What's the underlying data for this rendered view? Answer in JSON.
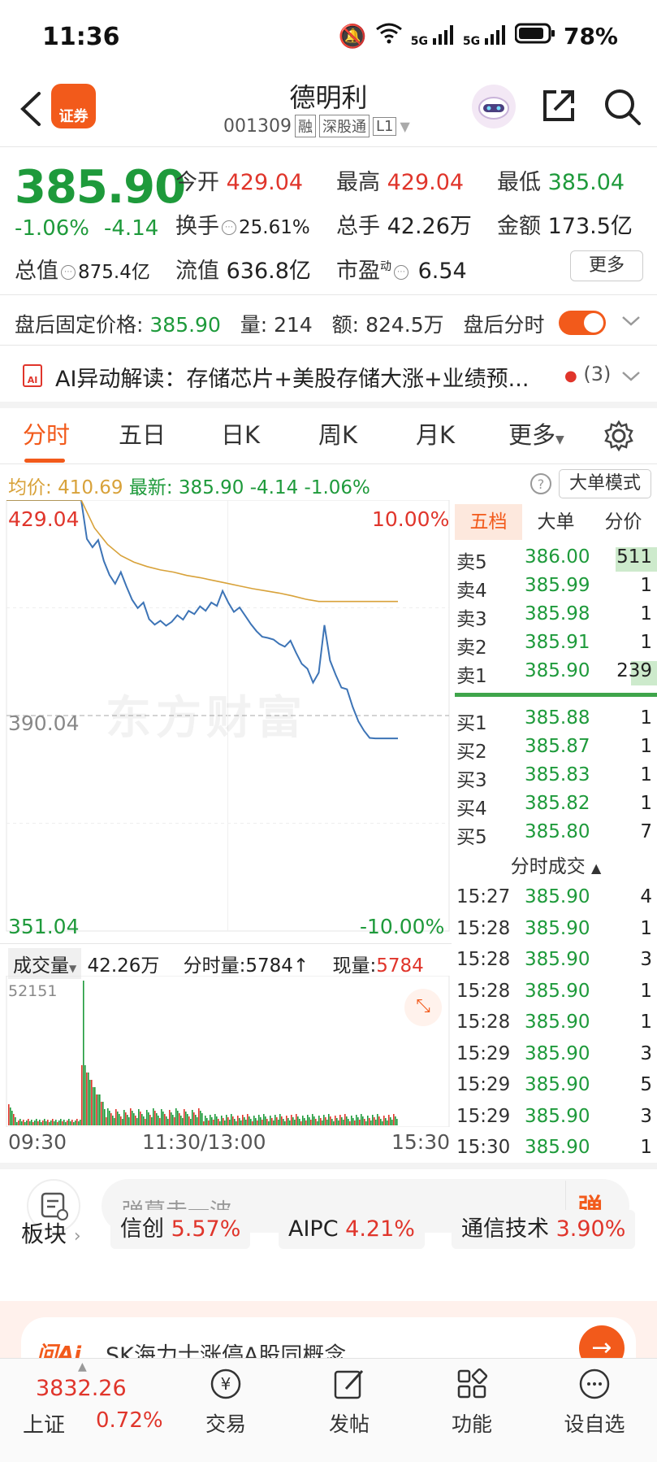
{
  "status": {
    "time": "11:36",
    "network": "5G",
    "battery": "78%"
  },
  "header": {
    "logo_text": "证券",
    "name": "德明利",
    "code": "001309",
    "tags": [
      "融",
      "深股通",
      "L1"
    ]
  },
  "quote": {
    "price": "385.90",
    "change_pct": "-1.06%",
    "change": "-4.14",
    "open_label": "今开",
    "open": "429.04",
    "high_label": "最高",
    "high": "429.04",
    "low_label": "最低",
    "low": "385.04",
    "turnover_label": "换手",
    "turnover": "25.61%",
    "volume_label": "总手",
    "volume": "42.26万",
    "amount_label": "金额",
    "amount": "173.5亿",
    "mktcap_label": "总值",
    "mktcap": "875.4亿",
    "float_label": "流值",
    "float": "636.8亿",
    "pe_label": "市盈",
    "pe_sup": "动",
    "pe": "6.54",
    "more_label": "更多"
  },
  "afterhours": {
    "label": "盘后固定价格:",
    "price": "385.90",
    "vol_label": "量:",
    "vol": "214",
    "amt_label": "额:",
    "amt": "824.5万",
    "toggle_label": "盘后分时"
  },
  "ai": {
    "text": "AI异动解读：存储芯片+美股存储大涨+业绩预...",
    "count": "(3)"
  },
  "tabs": [
    "分时",
    "五日",
    "日K",
    "周K",
    "月K",
    "更多"
  ],
  "avg_bar": {
    "avg_label": "均价:",
    "avg": "410.69",
    "latest_label": "最新:",
    "latest": "385.90",
    "chg": "-4.14",
    "pct": "-1.06%",
    "mode_label": "大单模式"
  },
  "chart_labels": {
    "top_price": "429.04",
    "top_pct": "10.00%",
    "mid_price": "390.04",
    "bot_price": "351.04",
    "bot_pct": "-10.00%",
    "watermark": "东方财富"
  },
  "chart_data": {
    "type": "line",
    "ylim": [
      351.04,
      429.04
    ],
    "x_ticks": [
      "09:30",
      "11:30/13:00",
      "15:30"
    ],
    "series": [
      {
        "values": [
          429.04,
          429.04,
          429.04,
          429.04,
          422.0,
          420.5,
          421.8,
          418.0,
          415.5,
          413.9,
          416.0,
          413.4,
          411.0,
          409.5,
          410.5,
          407.5,
          406.5,
          407.2,
          406.3,
          407.0,
          408.2,
          407.4,
          409.0,
          408.4,
          409.8,
          409.0,
          410.5,
          409.9,
          412.6,
          410.5,
          408.8,
          409.6,
          408.1,
          406.6,
          405.3,
          404.3,
          404.1,
          403.8,
          403.0,
          402.5,
          403.6,
          401.4,
          399.4,
          398.5,
          396.0,
          397.8,
          406.4,
          400.0,
          397.4,
          395.1,
          394.8,
          391.6,
          389.0,
          387.3,
          386.0,
          385.9,
          385.9,
          385.9,
          385.9,
          385.9
        ]
      },
      {
        "values": [
          429.04,
          424.0,
          421.0,
          419.0,
          417.8,
          417.0,
          416.4,
          416.0,
          415.4,
          415.0,
          414.5,
          414.0,
          413.5,
          413.0,
          412.6,
          412.2,
          411.7,
          411.1,
          410.69,
          410.69,
          410.69,
          410.69,
          410.69,
          410.69,
          410.69
        ]
      }
    ]
  },
  "orderbook": {
    "tabs": [
      "五档",
      "大单",
      "分价"
    ],
    "asks": [
      {
        "label": "卖5",
        "price": "386.00",
        "vol": "511",
        "bar": 0.55
      },
      {
        "label": "卖4",
        "price": "385.99",
        "vol": "1",
        "bar": 0
      },
      {
        "label": "卖3",
        "price": "385.98",
        "vol": "1",
        "bar": 0
      },
      {
        "label": "卖2",
        "price": "385.91",
        "vol": "1",
        "bar": 0
      },
      {
        "label": "卖1",
        "price": "385.90",
        "vol": "239",
        "bar": 0.3
      }
    ],
    "bids": [
      {
        "label": "买1",
        "price": "385.88",
        "vol": "1"
      },
      {
        "label": "买2",
        "price": "385.87",
        "vol": "1"
      },
      {
        "label": "买3",
        "price": "385.83",
        "vol": "1"
      },
      {
        "label": "买4",
        "price": "385.82",
        "vol": "1"
      },
      {
        "label": "买5",
        "price": "385.80",
        "vol": "7"
      }
    ],
    "ticks_title": "分时成交",
    "ticks": [
      {
        "time": "15:27",
        "price": "385.90",
        "vol": "4"
      },
      {
        "time": "15:28",
        "price": "385.90",
        "vol": "1"
      },
      {
        "time": "15:28",
        "price": "385.90",
        "vol": "3"
      },
      {
        "time": "15:28",
        "price": "385.90",
        "vol": "1"
      },
      {
        "time": "15:28",
        "price": "385.90",
        "vol": "1"
      },
      {
        "time": "15:29",
        "price": "385.90",
        "vol": "3"
      },
      {
        "time": "15:29",
        "price": "385.90",
        "vol": "5"
      },
      {
        "time": "15:29",
        "price": "385.90",
        "vol": "3"
      },
      {
        "time": "15:30",
        "price": "385.90",
        "vol": "1"
      }
    ]
  },
  "volume": {
    "label": "成交量",
    "total": "42.26万",
    "tick_label": "分时量:",
    "tick": "5784↑",
    "now_label": "现量:",
    "now": "5784",
    "max": "52151"
  },
  "comment": {
    "placeholder": "弹幕走一波...",
    "send": "弹"
  },
  "sectors": {
    "label": "板块",
    "chips": [
      {
        "name": "信创",
        "pct": "5.57%"
      },
      {
        "name": "AIPC",
        "pct": "4.21%"
      },
      {
        "name": "通信技术",
        "pct": "3.90%"
      }
    ]
  },
  "promo": {
    "ai": "问Ai",
    "text": "SK海力士涨停A股同概念"
  },
  "nav": {
    "index_value": "3832.26",
    "index_name": "上证",
    "index_pct": "0.72%",
    "items": [
      "交易",
      "发帖",
      "功能",
      "设自选"
    ]
  },
  "colors": {
    "accent": "#f25a1b",
    "up": "#e0352b",
    "down": "#1e9a3b",
    "avg": "#d8a23a",
    "line": "#3d74b6"
  }
}
